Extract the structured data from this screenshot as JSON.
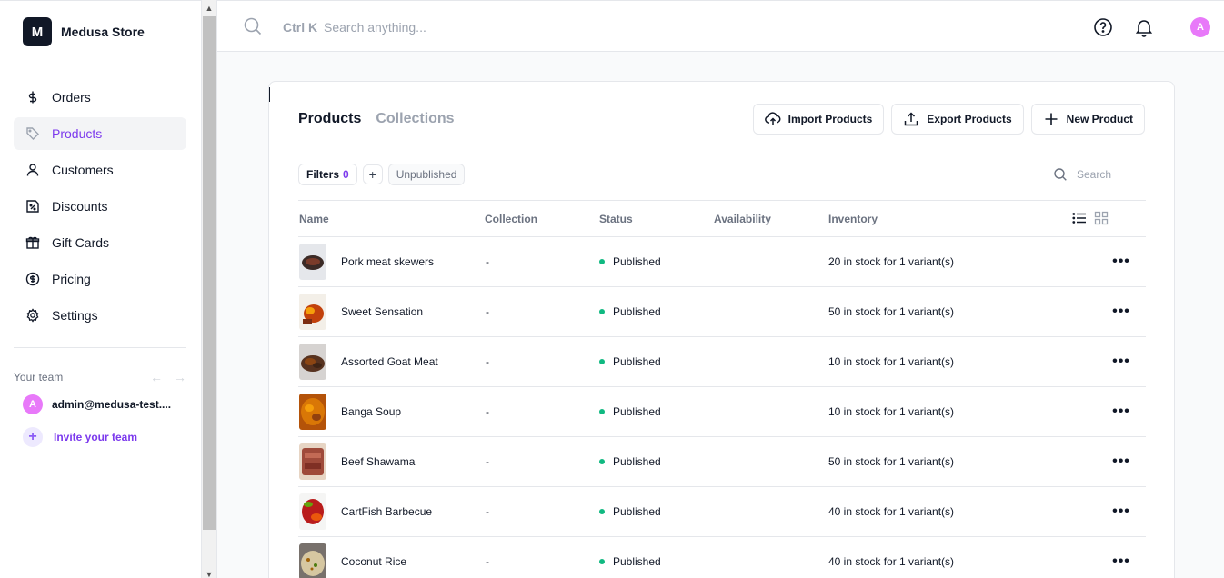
{
  "store": {
    "logo_letter": "M",
    "name": "Medusa Store"
  },
  "nav": {
    "items": [
      {
        "label": "Orders",
        "icon": "dollar-icon"
      },
      {
        "label": "Products",
        "icon": "tag-icon",
        "active": true
      },
      {
        "label": "Customers",
        "icon": "user-icon"
      },
      {
        "label": "Discounts",
        "icon": "discount-icon"
      },
      {
        "label": "Gift Cards",
        "icon": "gift-icon"
      },
      {
        "label": "Pricing",
        "icon": "pricing-icon"
      },
      {
        "label": "Settings",
        "icon": "gear-icon"
      }
    ]
  },
  "team": {
    "heading": "Your team",
    "member": {
      "initial": "A",
      "email": "admin@medusa-test...."
    },
    "invite_label": "Invite your team"
  },
  "topbar": {
    "shortcut": "Ctrl K",
    "search_placeholder": "Search anything...",
    "avatar_initial": "A"
  },
  "tabs": {
    "products": "Products",
    "collections": "Collections"
  },
  "actions": {
    "import": "Import Products",
    "export": "Export Products",
    "new": "New Product"
  },
  "filters": {
    "label": "Filters",
    "count": "0",
    "add": "+",
    "tag": "Unpublished",
    "search_placeholder": "Search"
  },
  "table": {
    "headers": {
      "name": "Name",
      "collection": "Collection",
      "status": "Status",
      "availability": "Availability",
      "inventory": "Inventory"
    },
    "rows": [
      {
        "name": "Pork meat skewers",
        "collection": "-",
        "status": "Published",
        "inventory": "20 in stock for 1 variant(s)"
      },
      {
        "name": "Sweet Sensation",
        "collection": "-",
        "status": "Published",
        "inventory": "50 in stock for 1 variant(s)"
      },
      {
        "name": "Assorted Goat Meat",
        "collection": "-",
        "status": "Published",
        "inventory": "10 in stock for 1 variant(s)"
      },
      {
        "name": "Banga Soup",
        "collection": "-",
        "status": "Published",
        "inventory": "10 in stock for 1 variant(s)"
      },
      {
        "name": "Beef Shawama",
        "collection": "-",
        "status": "Published",
        "inventory": "50 in stock for 1 variant(s)"
      },
      {
        "name": "CartFish Barbecue",
        "collection": "-",
        "status": "Published",
        "inventory": "40 in stock for 1 variant(s)"
      },
      {
        "name": "Coconut Rice",
        "collection": "-",
        "status": "Published",
        "inventory": "40 in stock for 1 variant(s)"
      }
    ],
    "row_menu": "•••"
  }
}
